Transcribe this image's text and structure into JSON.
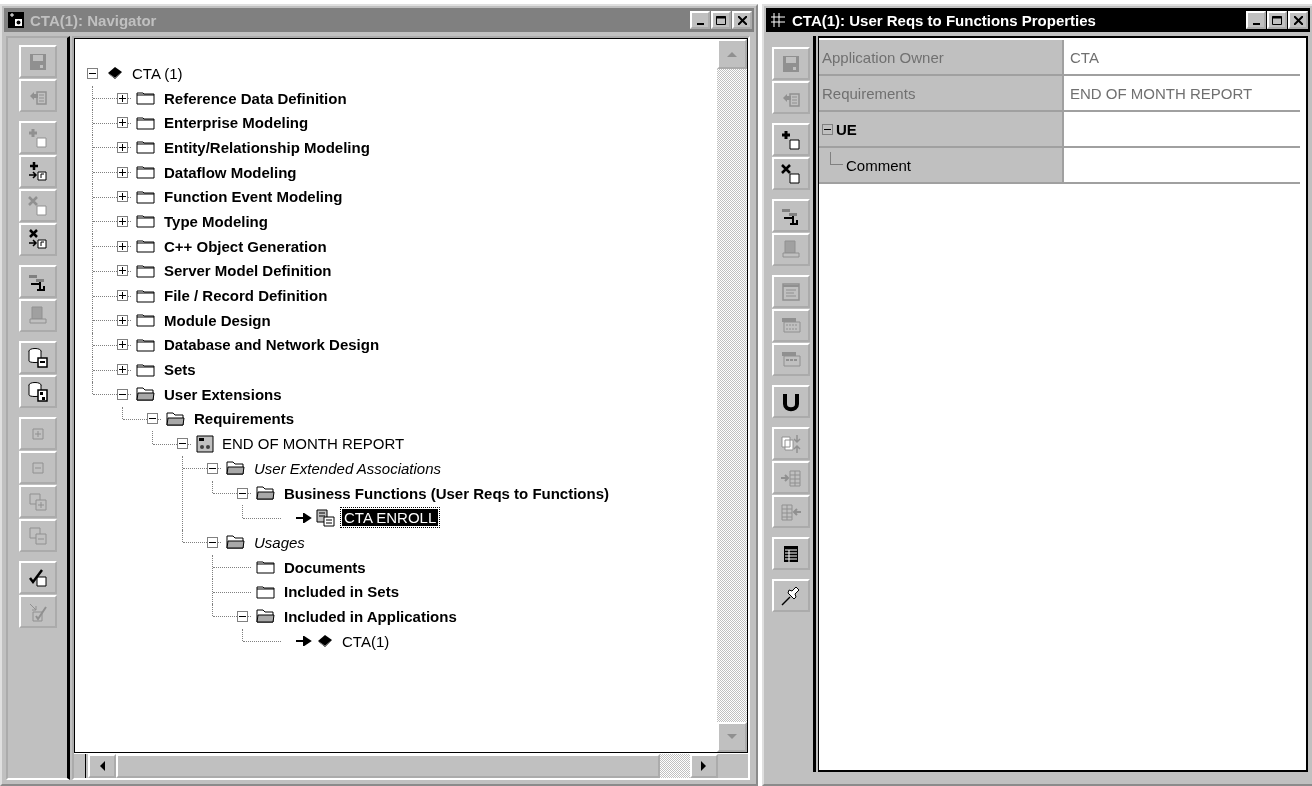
{
  "navigator": {
    "title": "CTA(1): Navigator",
    "active": false,
    "toolbar": [
      {
        "buttons": [
          {
            "kind": "save",
            "disabled": true
          },
          {
            "kind": "copy",
            "disabled": true
          }
        ]
      },
      {
        "buttons": [
          {
            "kind": "add",
            "disabled": true
          },
          {
            "kind": "add-link",
            "disabled": false
          },
          {
            "kind": "delete",
            "disabled": true
          },
          {
            "kind": "delete-link",
            "disabled": false
          }
        ]
      },
      {
        "buttons": [
          {
            "kind": "hierarchy",
            "disabled": false
          },
          {
            "kind": "print",
            "disabled": true
          }
        ]
      },
      {
        "buttons": [
          {
            "kind": "diagram",
            "disabled": false
          },
          {
            "kind": "matrix",
            "disabled": false
          }
        ]
      },
      {
        "buttons": [
          {
            "kind": "expand",
            "disabled": true
          },
          {
            "kind": "collapse",
            "disabled": true
          },
          {
            "kind": "expand-all",
            "disabled": true
          },
          {
            "kind": "collapse-all",
            "disabled": true
          }
        ]
      },
      {
        "buttons": [
          {
            "kind": "check",
            "disabled": false
          },
          {
            "kind": "check-in",
            "disabled": true
          }
        ]
      }
    ],
    "tree": [
      {
        "label": "CTA (1)",
        "kind": "application",
        "expanded": true,
        "selected": false,
        "linked": false,
        "children": [
          {
            "label": "Reference Data Definition",
            "kind": "category",
            "expanded": false,
            "selected": false,
            "linked": false
          },
          {
            "label": "Enterprise Modeling",
            "kind": "category",
            "expanded": false,
            "selected": false,
            "linked": false
          },
          {
            "label": "Entity/Relationship Modeling",
            "kind": "category",
            "expanded": false,
            "selected": false,
            "linked": false
          },
          {
            "label": "Dataflow Modeling",
            "kind": "category",
            "expanded": false,
            "selected": false,
            "linked": false
          },
          {
            "label": "Function Event Modeling",
            "kind": "category",
            "expanded": false,
            "selected": false,
            "linked": false
          },
          {
            "label": "Type Modeling",
            "kind": "category",
            "expanded": false,
            "selected": false,
            "linked": false
          },
          {
            "label": "C++ Object Generation",
            "kind": "category",
            "expanded": false,
            "selected": false,
            "linked": false
          },
          {
            "label": "Server Model Definition",
            "kind": "category",
            "expanded": false,
            "selected": false,
            "linked": false
          },
          {
            "label": "File / Record Definition",
            "kind": "category",
            "expanded": false,
            "selected": false,
            "linked": false
          },
          {
            "label": "Module Design",
            "kind": "category",
            "expanded": false,
            "selected": false,
            "linked": false
          },
          {
            "label": "Database and Network Design",
            "kind": "category",
            "expanded": false,
            "selected": false,
            "linked": false
          },
          {
            "label": "Sets",
            "kind": "category",
            "expanded": false,
            "selected": false,
            "linked": false
          },
          {
            "label": "User Extensions",
            "kind": "category",
            "expanded": true,
            "selected": false,
            "linked": false,
            "children": [
              {
                "label": "Requirements",
                "kind": "category",
                "expanded": true,
                "selected": false,
                "linked": false,
                "children": [
                  {
                    "label": "END OF MONTH REPORT",
                    "kind": "requirement",
                    "expanded": true,
                    "selected": false,
                    "linked": false,
                    "children": [
                      {
                        "label": "User Extended Associations",
                        "kind": "group",
                        "expanded": true,
                        "selected": false,
                        "linked": false,
                        "children": [
                          {
                            "label": "Business Functions (User Reqs to Functions)",
                            "kind": "category",
                            "expanded": true,
                            "selected": false,
                            "linked": false,
                            "children": [
                              {
                                "label": "CTA ENROLL",
                                "kind": "function",
                                "selected": true,
                                "linked": true
                              }
                            ]
                          }
                        ]
                      },
                      {
                        "label": "Usages",
                        "kind": "group",
                        "expanded": true,
                        "selected": false,
                        "linked": false,
                        "children": [
                          {
                            "label": "Documents",
                            "kind": "category",
                            "selected": false,
                            "linked": false
                          },
                          {
                            "label": "Included in Sets",
                            "kind": "category",
                            "selected": false,
                            "linked": false
                          },
                          {
                            "label": "Included in Applications",
                            "kind": "category",
                            "expanded": true,
                            "selected": false,
                            "linked": false,
                            "children": [
                              {
                                "label": "CTA(1)",
                                "kind": "application",
                                "selected": false,
                                "linked": true
                              }
                            ]
                          }
                        ]
                      }
                    ]
                  }
                ]
              }
            ]
          }
        ]
      }
    ]
  },
  "properties": {
    "title": "CTA(1): User Reqs to Functions Properties",
    "active": true,
    "toolbar": [
      {
        "buttons": [
          {
            "kind": "save",
            "disabled": true
          },
          {
            "kind": "copy",
            "disabled": true
          }
        ]
      },
      {
        "buttons": [
          {
            "kind": "add",
            "disabled": false
          },
          {
            "kind": "delete",
            "disabled": false
          }
        ]
      },
      {
        "buttons": [
          {
            "kind": "hierarchy",
            "disabled": false
          },
          {
            "kind": "print",
            "disabled": true
          }
        ]
      },
      {
        "buttons": [
          {
            "kind": "report",
            "disabled": true
          },
          {
            "kind": "ascii",
            "disabled": true
          },
          {
            "kind": "html",
            "disabled": true
          }
        ]
      },
      {
        "buttons": [
          {
            "kind": "u",
            "disabled": false
          }
        ]
      },
      {
        "buttons": [
          {
            "kind": "swap",
            "disabled": true
          },
          {
            "kind": "import",
            "disabled": true
          },
          {
            "kind": "export",
            "disabled": true
          }
        ]
      },
      {
        "buttons": [
          {
            "kind": "grid",
            "disabled": false
          }
        ]
      },
      {
        "buttons": [
          {
            "kind": "pin",
            "disabled": false
          }
        ]
      }
    ],
    "rows": [
      {
        "kind": "field",
        "label": "Application Owner",
        "value": "CTA",
        "read_only": true
      },
      {
        "kind": "field",
        "label": "Requirements",
        "value": "END OF MONTH REPORT",
        "read_only": true
      },
      {
        "kind": "group",
        "label": "UE",
        "expanded": true,
        "children": [
          {
            "kind": "field",
            "label": "Comment",
            "read_only": false
          }
        ]
      }
    ]
  }
}
